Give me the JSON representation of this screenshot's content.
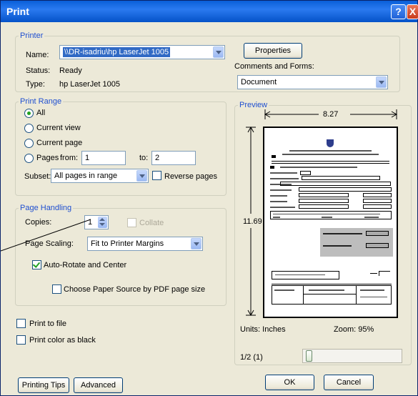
{
  "window": {
    "title": "Print",
    "help_icon": "?",
    "close_icon": "X"
  },
  "printer": {
    "legend": "Printer",
    "name_label": "Name:",
    "name_value": "\\\\DR-isadriu\\hp LaserJet 1005",
    "status_label": "Status:",
    "status_value": "Ready",
    "type_label": "Type:",
    "type_value": "hp LaserJet 1005",
    "properties_button": "Properties",
    "comments_label": "Comments and Forms:",
    "comments_value": "Document"
  },
  "print_range": {
    "legend": "Print Range",
    "options": [
      "All",
      "Current view",
      "Current page",
      "Pages"
    ],
    "selected": "All",
    "from_label": "from:",
    "from_value": "1",
    "to_label": "to:",
    "to_value": "2",
    "subset_label": "Subset:",
    "subset_value": "All pages in range",
    "reverse_label": "Reverse pages"
  },
  "page_handling": {
    "legend": "Page Handling",
    "copies_label": "Copies:",
    "copies_value": "1",
    "collate_label": "Collate",
    "scaling_label": "Page Scaling:",
    "scaling_value": "Fit to Printer Margins",
    "auto_rotate_label": "Auto-Rotate and Center",
    "auto_rotate_checked": true,
    "paper_source_label": "Choose Paper Source by PDF page size",
    "paper_source_checked": false
  },
  "options": {
    "print_to_file": "Print to file",
    "print_color_black": "Print color as black"
  },
  "preview": {
    "legend": "Preview",
    "width": "8.27",
    "height": "11.69",
    "units": "Units: Inches",
    "zoom": "Zoom:  95%",
    "page_counter": "1/2 (1)"
  },
  "buttons": {
    "printing_tips": "Printing Tips",
    "advanced": "Advanced",
    "ok": "OK",
    "cancel": "Cancel"
  }
}
